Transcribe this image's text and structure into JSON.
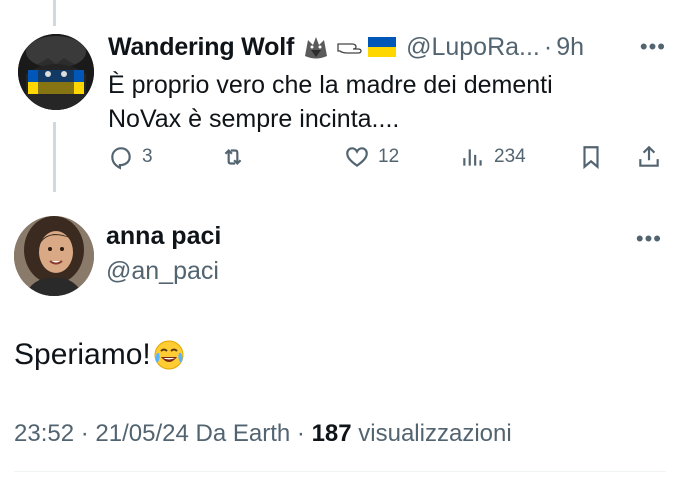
{
  "reply_parent": {
    "display_name": "Wandering Wolf",
    "name_emojis": [
      "wolf-emoji",
      "pointing-hand-emoji",
      "ukraine-flag-emoji"
    ],
    "handle": "@LupoRa...",
    "separator": "·",
    "time": "9h",
    "text_line1": "È proprio vero che la madre dei dementi",
    "text_line2": "NoVax è sempre incinta....",
    "actions": {
      "replies": "3",
      "reposts": "",
      "likes": "12",
      "views": "234"
    }
  },
  "main_post": {
    "display_name": "anna paci",
    "handle": "@an_paci",
    "text": "Speriamo!",
    "emoji": "face-with-tears-of-joy",
    "time": "23:52",
    "date": "21/05/24",
    "source": "Da Earth",
    "views_count": "187",
    "views_label": "visualizzazioni",
    "separator": "·"
  },
  "colors": {
    "text_primary": "#0f1419",
    "text_secondary": "#536471",
    "thread_line": "#cfd9de",
    "ukraine_blue": "#0057b7",
    "ukraine_yellow": "#ffd700"
  }
}
